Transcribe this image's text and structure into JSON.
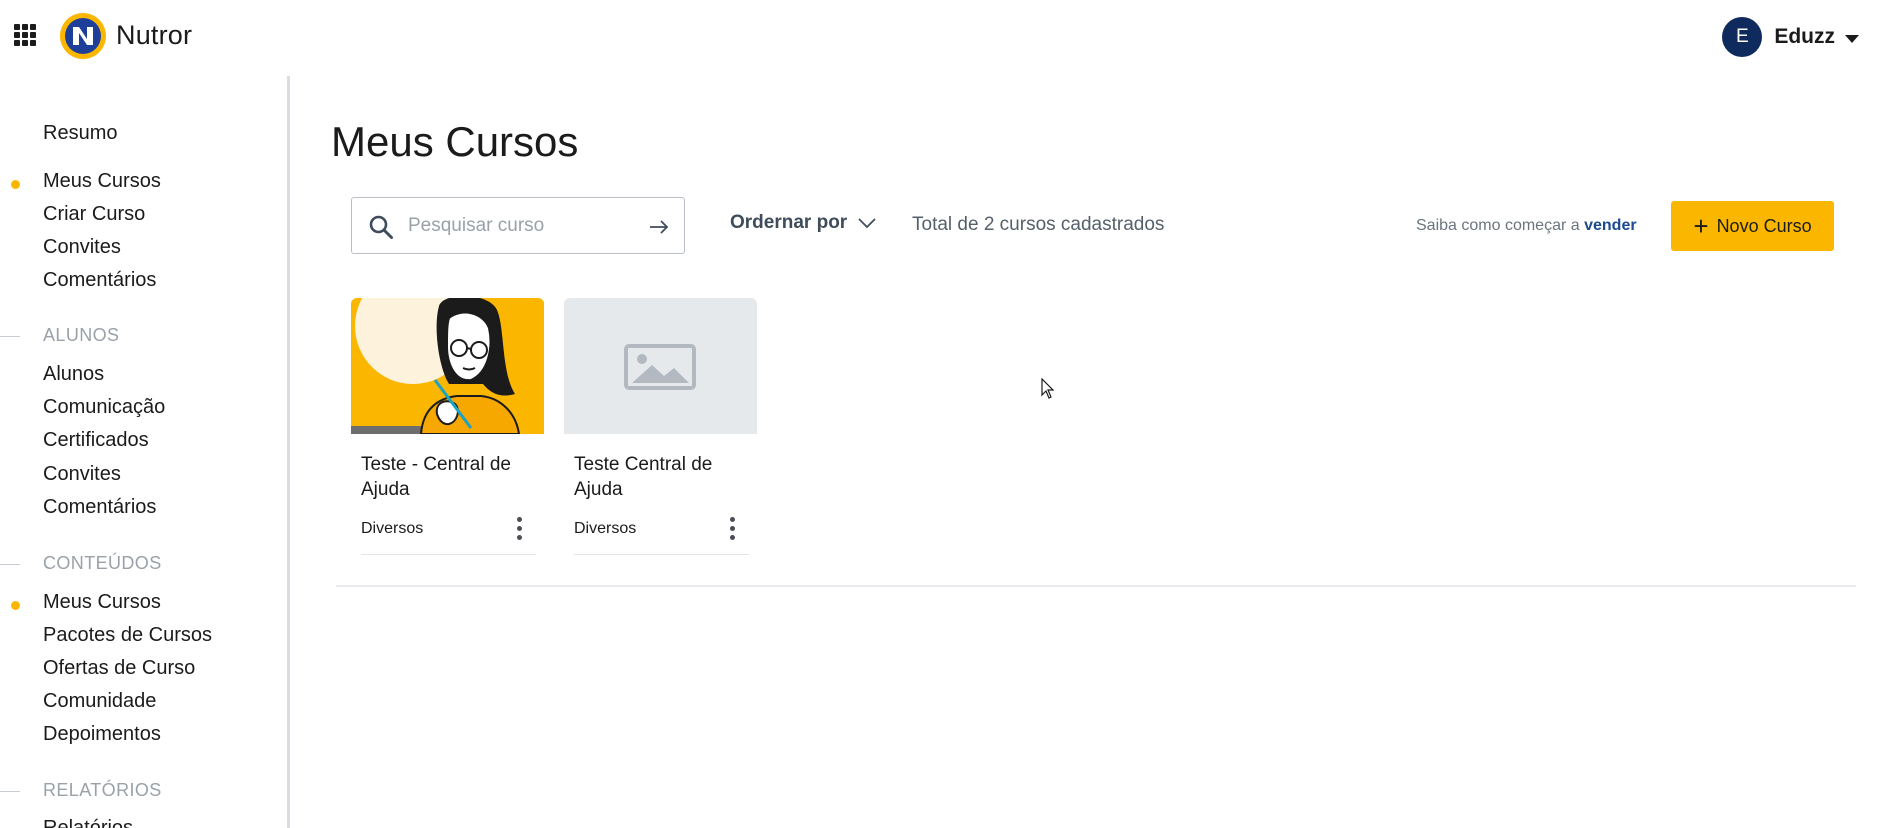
{
  "header": {
    "brand": "Nutror",
    "user_initial": "E",
    "user_name": "Eduzz"
  },
  "sidebar": {
    "group_main": [
      {
        "label": "Resumo",
        "active": false
      },
      {
        "label": "Meus Cursos",
        "active": true
      },
      {
        "label": "Criar Curso",
        "active": false
      },
      {
        "label": "Convites",
        "active": false
      },
      {
        "label": "Comentários",
        "active": false
      }
    ],
    "section_alunos": "ALUNOS",
    "group_alunos": [
      {
        "label": "Alunos"
      },
      {
        "label": "Comunicação"
      },
      {
        "label": "Certificados"
      },
      {
        "label": "Convites"
      },
      {
        "label": "Comentários"
      }
    ],
    "section_conteudos": "CONTEÚDOS",
    "group_conteudos": [
      {
        "label": "Meus Cursos",
        "active": true
      },
      {
        "label": "Pacotes de Cursos"
      },
      {
        "label": "Ofertas de Curso"
      },
      {
        "label": "Comunidade"
      },
      {
        "label": "Depoimentos"
      }
    ],
    "section_relatorios": "RELATÓRIOS",
    "group_relatorios": [
      {
        "label": "Relatórios"
      }
    ]
  },
  "main": {
    "title": "Meus Cursos",
    "search_placeholder": "Pesquisar curso",
    "sort_label": "Ordernar por",
    "total_text": "Total de 2 cursos cadastrados",
    "howto_text": "Saiba como começar a",
    "howto_link": "vender",
    "new_button": "Novo Curso"
  },
  "courses": [
    {
      "title": "Teste - Central de Ajuda",
      "category": "Diversos",
      "thumbnail": "illustration-woman-glasses"
    },
    {
      "title": "Teste Central de Ajuda",
      "category": "Diversos",
      "thumbnail": "image-placeholder-icon"
    }
  ],
  "colors": {
    "accent": "#fbb700",
    "avatar": "#0f2a5c",
    "link": "#1d4a8f"
  }
}
